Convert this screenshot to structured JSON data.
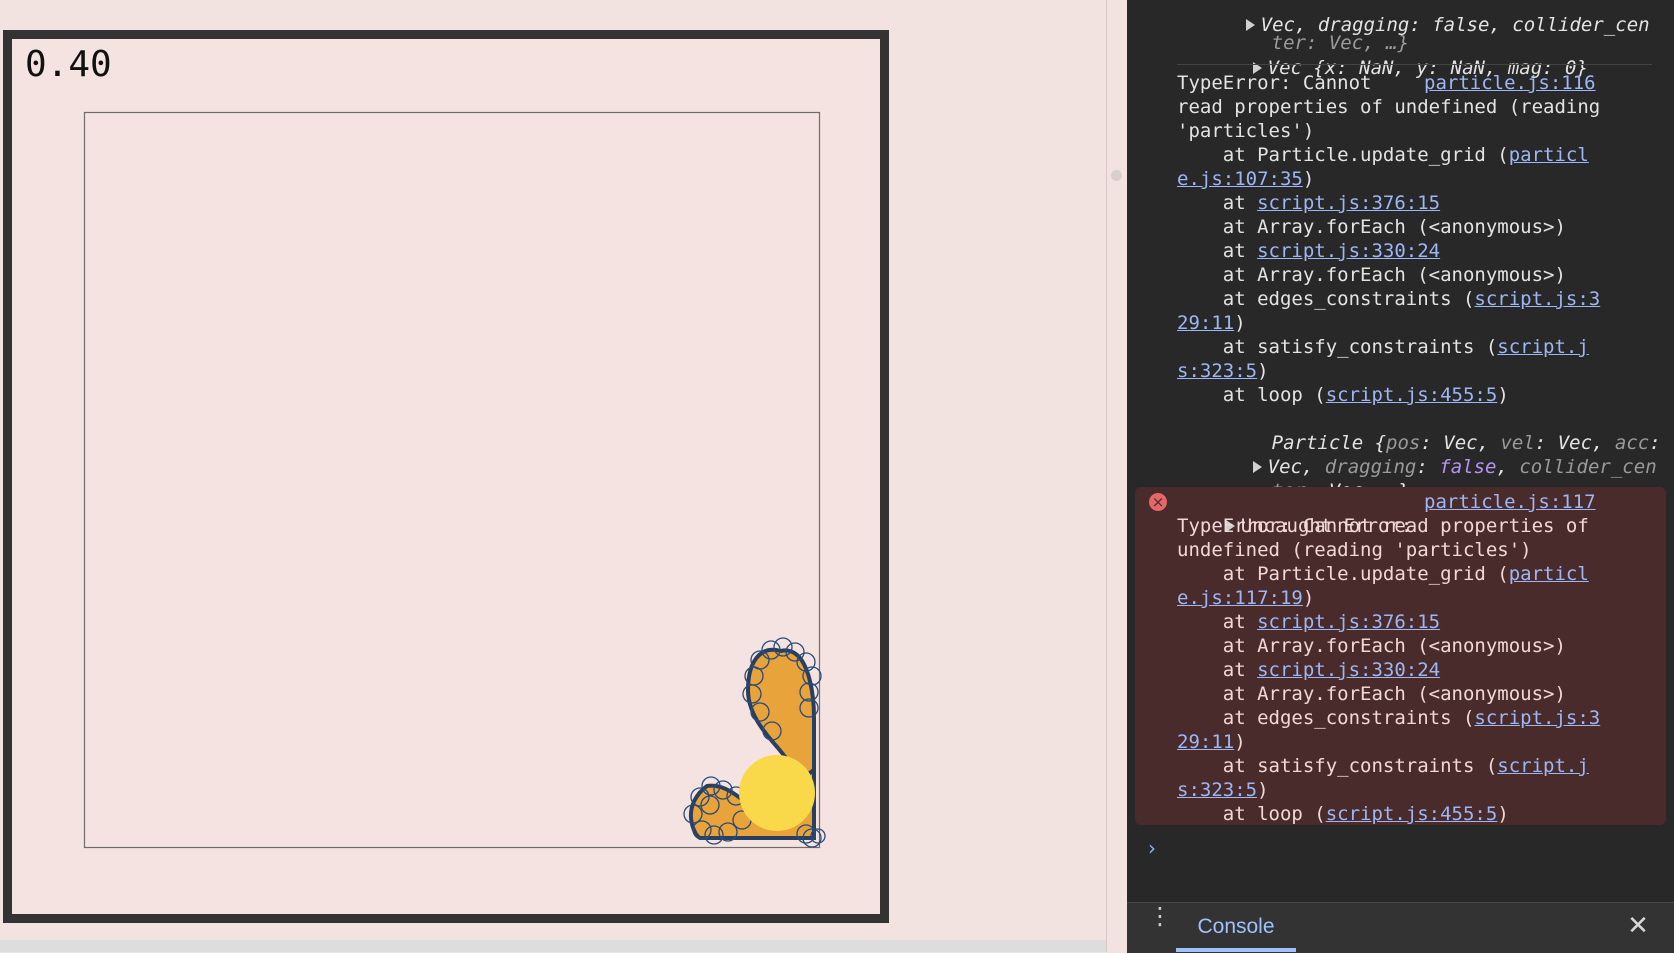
{
  "simulation": {
    "fps_value": "0.40",
    "colors": {
      "background": "#f4e3e0",
      "frame": "#333333",
      "body_fill": "#e8a33a",
      "body_outline": "#2a3f5f",
      "particle_circle": "#2a4a7a",
      "ball": "#f9d84a"
    }
  },
  "console": {
    "prev_object": {
      "line1": "Vec, dragging: false, collider_cen",
      "line2": "ter: Vec, …}",
      "vec_label": "Vec {x: NaN, y: NaN, mag: 0}"
    },
    "warning": {
      "head1": "TypeError: Cannot",
      "source": "particle.js:116",
      "head2": "read properties of undefined (reading",
      "head3": "'particles')",
      "stack": [
        {
          "pre": "    at Particle.update_grid (",
          "link": "particl",
          "post": ""
        },
        {
          "pre": "",
          "link": "e.js:107:35",
          "post": ")"
        },
        {
          "pre": "    at ",
          "link": "script.js:376:15",
          "post": ""
        },
        {
          "pre": "    at Array.forEach (<anonymous>)",
          "link": "",
          "post": ""
        },
        {
          "pre": "    at ",
          "link": "script.js:330:24",
          "post": ""
        },
        {
          "pre": "    at Array.forEach (<anonymous>)",
          "link": "",
          "post": ""
        },
        {
          "pre": "    at edges_constraints (",
          "link": "script.js:3",
          "post": ""
        },
        {
          "pre": "",
          "link": "29:11",
          "post": ")"
        },
        {
          "pre": "    at satisfy_constraints (",
          "link": "script.j",
          "post": ""
        },
        {
          "pre": "",
          "link": "s:323:5",
          "post": ")"
        },
        {
          "pre": "    at loop (",
          "link": "script.js:455:5",
          "post": ")"
        }
      ],
      "obj1_name": "Particle {",
      "obj1_k1": "pos",
      "obj1_v1": "Vec",
      "obj1_k2": "vel",
      "obj1_v2": "Vec",
      "obj1_k3": "acc",
      "obj2_v": "Vec",
      "obj2_k": "dragging",
      "obj2_bool": "false",
      "obj2_tail": "collider_cen",
      "obj3_k": "ter",
      "obj3_v": "Vec, …}"
    },
    "error": {
      "title": "Uncaught Error:",
      "source": "particle.js:117",
      "line2": "TypeError: Cannot read properties of",
      "line3": "undefined (reading 'particles')",
      "stack": [
        {
          "pre": "    at Particle.update_grid (",
          "link": "particl",
          "post": ""
        },
        {
          "pre": "",
          "link": "e.js:117:19",
          "post": ")"
        },
        {
          "pre": "    at ",
          "link": "script.js:376:15",
          "post": ""
        },
        {
          "pre": "    at Array.forEach (<anonymous>)",
          "link": "",
          "post": ""
        },
        {
          "pre": "    at ",
          "link": "script.js:330:24",
          "post": ""
        },
        {
          "pre": "    at Array.forEach (<anonymous>)",
          "link": "",
          "post": ""
        },
        {
          "pre": "    at edges_constraints (",
          "link": "script.js:3",
          "post": ""
        },
        {
          "pre": "",
          "link": "29:11",
          "post": ")"
        },
        {
          "pre": "    at satisfy_constraints (",
          "link": "script.j",
          "post": ""
        },
        {
          "pre": "",
          "link": "s:323:5",
          "post": ")"
        },
        {
          "pre": "    at loop (",
          "link": "script.js:455:5",
          "post": ")"
        }
      ]
    },
    "prompt_symbol": "›"
  },
  "drawer": {
    "tab_console": "Console",
    "menu_glyph": "⋮",
    "close_glyph": "✕"
  }
}
